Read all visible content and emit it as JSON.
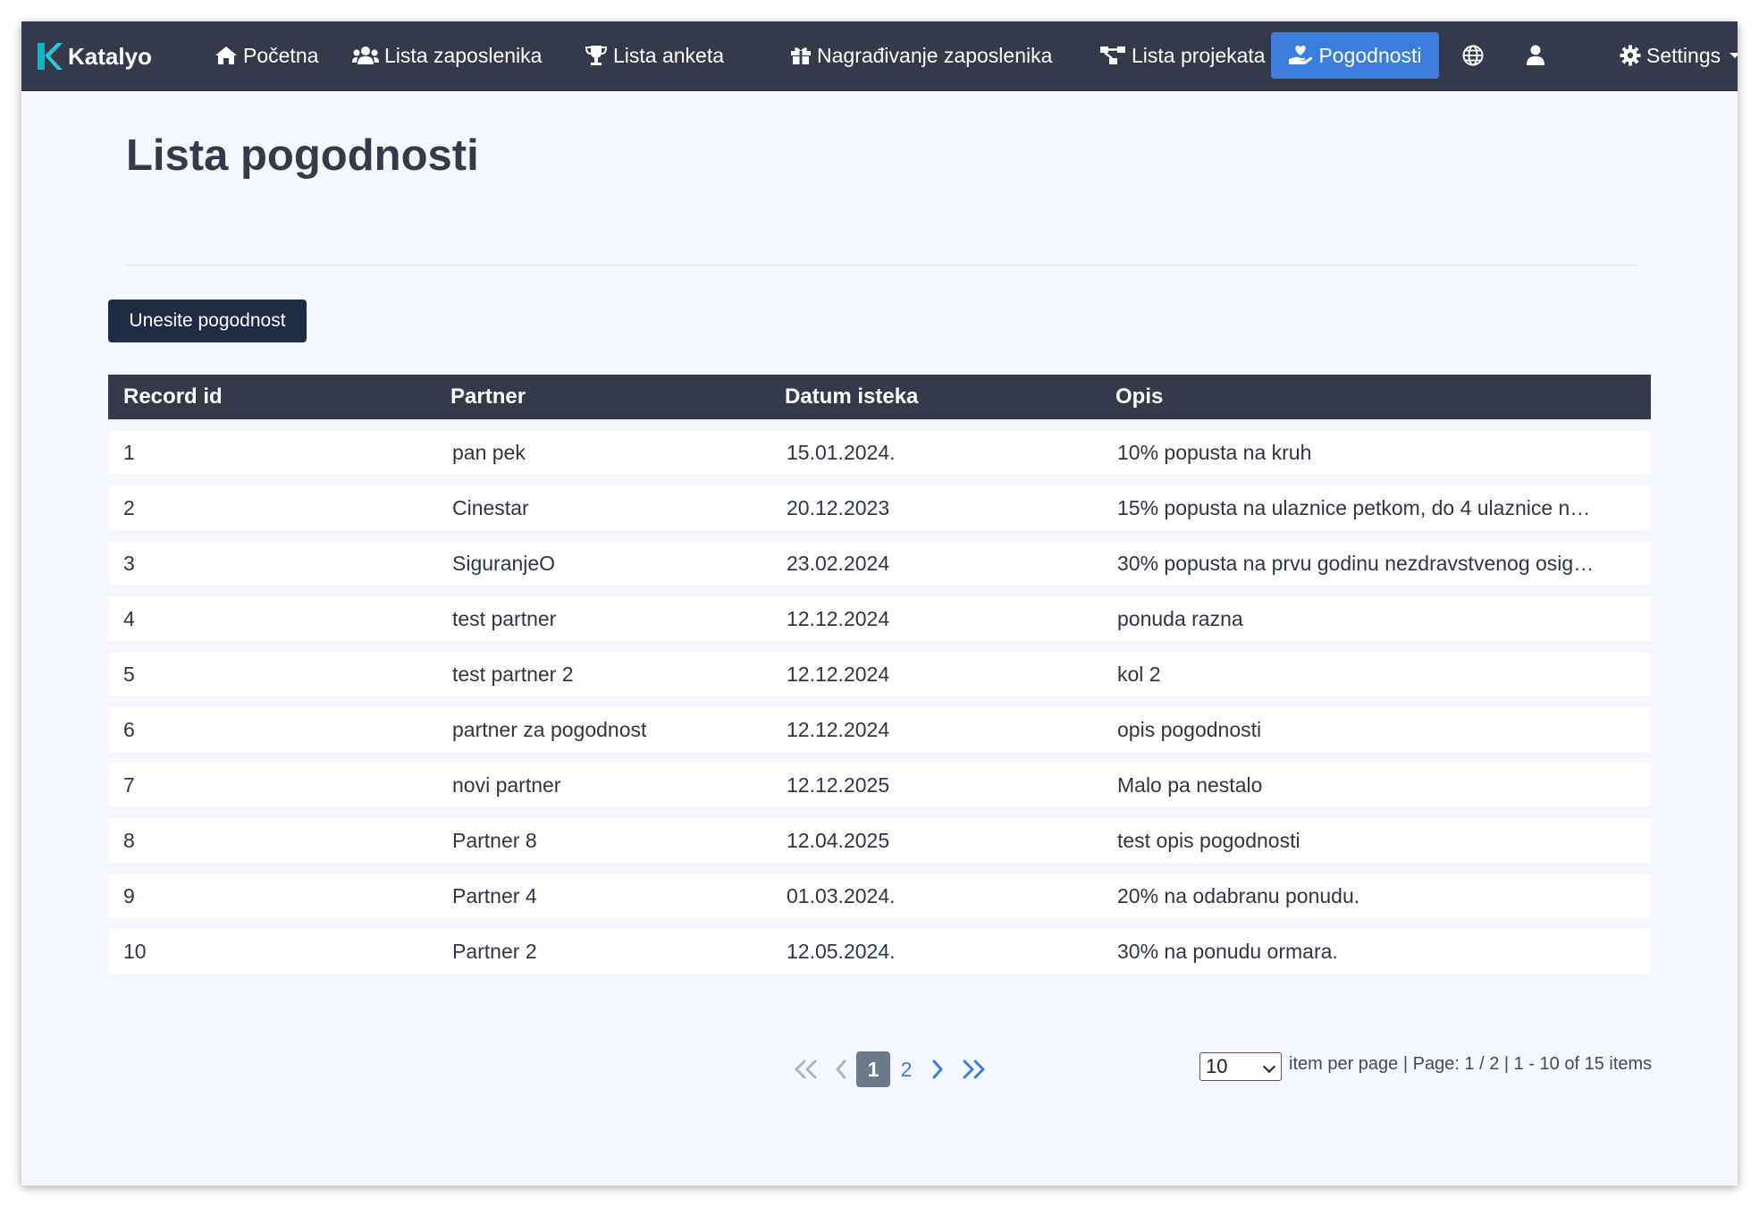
{
  "navbar": {
    "brand": "Katalyo",
    "items": [
      {
        "label": "Početna",
        "icon": "home-icon"
      },
      {
        "label": "Lista zaposlenika",
        "icon": "users-icon"
      },
      {
        "label": "Lista anketa",
        "icon": "trophy-icon"
      },
      {
        "label": "Nagrađivanje zaposlenika",
        "icon": "gift-icon"
      },
      {
        "label": "Lista projekata",
        "icon": "project-diagram-icon"
      },
      {
        "label": "Pogodnosti",
        "icon": "hand-holding-heart-icon",
        "active": true
      }
    ],
    "language_icon": "globe-icon",
    "user_icon": "user-icon",
    "settings": {
      "label": "Settings",
      "icon": "gear-icon"
    },
    "colors": {
      "background": "#343a4a",
      "active": "#3b7ddd"
    }
  },
  "main": {
    "title": "Lista pogodnosti",
    "add_button": "Unesite pogodnost",
    "table": {
      "columns": [
        "Record id",
        "Partner",
        "Datum isteka",
        "Opis"
      ],
      "rows": [
        [
          "1",
          "pan pek",
          "15.01.2024.",
          "10% popusta na kruh"
        ],
        [
          "2",
          "Cinestar",
          "20.12.2023",
          "15% popusta na ulaznice petkom, do 4 ulaznice n…"
        ],
        [
          "3",
          "SiguranjeO",
          "23.02.2024",
          "30% popusta na prvu godinu nezdravstvenog osig…"
        ],
        [
          "4",
          "test partner",
          "12.12.2024",
          "ponuda razna"
        ],
        [
          "5",
          "test partner 2",
          "12.12.2024",
          "kol 2"
        ],
        [
          "6",
          "partner za pogodnost",
          "12.12.2024",
          "opis pogodnosti"
        ],
        [
          "7",
          "novi partner",
          "12.12.2025",
          "Malo pa nestalo"
        ],
        [
          "8",
          "Partner 8",
          "12.04.2025",
          "test opis pogodnosti"
        ],
        [
          "9",
          "Partner 4",
          "01.03.2024.",
          "20% na odabranu ponudu."
        ],
        [
          "10",
          "Partner 2",
          "12.05.2024.",
          "30% na ponudu ormara."
        ]
      ]
    },
    "pagination": {
      "pages": [
        "1",
        "2"
      ],
      "current_page": "1",
      "page_size": "10",
      "info": "item per page | Page: 1 / 2 | 1 - 10 of 15 items"
    }
  }
}
